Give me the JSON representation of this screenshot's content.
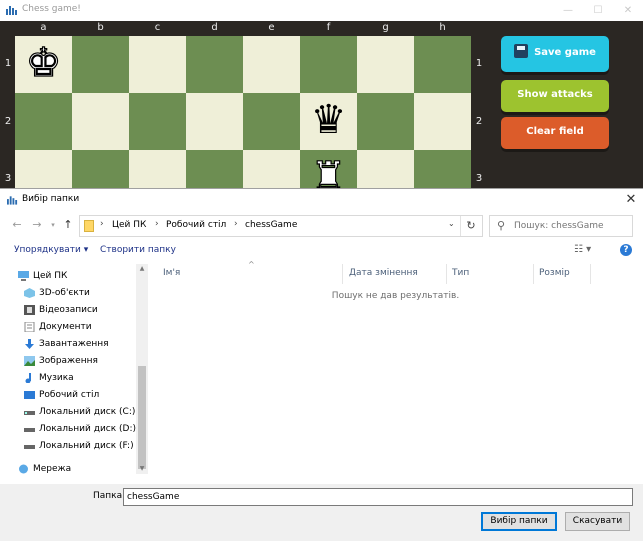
{
  "chess_window": {
    "title": "Chess game!",
    "files": [
      "a",
      "b",
      "c",
      "d",
      "e",
      "f",
      "g",
      "h"
    ],
    "ranks": [
      "1",
      "2",
      "3"
    ],
    "pieces": {
      "king": "♚",
      "queen": "♛",
      "rook": "♜"
    },
    "buttons": {
      "save": "Save game",
      "show_attacks": "Show attacks",
      "clear": "Clear field"
    },
    "colors": {
      "light_square": "#efefd8",
      "dark_square": "#6d8e52",
      "save": "#25c5e3",
      "attacks": "#9dc32f",
      "clear": "#dc5c2a"
    }
  },
  "dialog": {
    "title": "Вибір папки",
    "breadcrumb": [
      "Цей ПК",
      "Робочий стіл",
      "chessGame"
    ],
    "search_placeholder": "Пошук: chessGame",
    "commands": {
      "organize": "Упорядкувати ▾",
      "new_folder": "Створити папку"
    },
    "nav_items": [
      {
        "label": "Цей ПК",
        "icon": "computer-icon"
      },
      {
        "label": "3D-об'єкти",
        "icon": "cube-3d-icon"
      },
      {
        "label": "Відеозаписи",
        "icon": "video-icon"
      },
      {
        "label": "Документи",
        "icon": "document-icon"
      },
      {
        "label": "Завантаження",
        "icon": "download-icon"
      },
      {
        "label": "Зображення",
        "icon": "image-icon"
      },
      {
        "label": "Музика",
        "icon": "music-icon"
      },
      {
        "label": "Робочий стіл",
        "icon": "desktop-icon"
      },
      {
        "label": "Локальний диск (C:)",
        "icon": "drive-icon"
      },
      {
        "label": "Локальний диск (D:)",
        "icon": "drive-icon"
      },
      {
        "label": "Локальний диск (F:)",
        "icon": "drive-icon"
      },
      {
        "label": "Мережа",
        "icon": "network-icon"
      }
    ],
    "columns": [
      "Ім'я",
      "Дата змінення",
      "Тип",
      "Розмір"
    ],
    "empty_message": "Пошук не дав результатів.",
    "folder_label": "Папка:",
    "folder_value": "chessGame",
    "select_button": "Вибір папки",
    "cancel_button": "Скасувати"
  }
}
